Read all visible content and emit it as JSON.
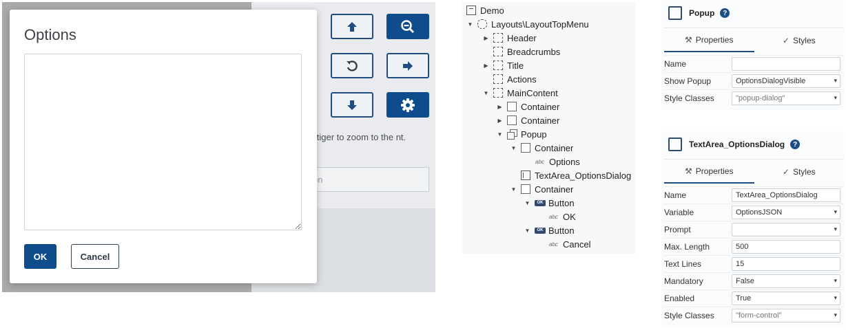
{
  "app": {
    "hint_text": "k the tiger to zoom to the nt.",
    "input_placeholder": "on",
    "buttons": [
      {
        "name": "pan-up-button",
        "icon": "arrow-up-icon"
      },
      {
        "name": "zoom-out-button",
        "icon": "zoom-out-icon"
      },
      {
        "name": "reset-button",
        "icon": "undo-icon"
      },
      {
        "name": "pan-right-button",
        "icon": "arrow-right-icon"
      },
      {
        "name": "pan-down-button",
        "icon": "arrow-down-icon"
      },
      {
        "name": "settings-button",
        "icon": "gear-icon"
      }
    ]
  },
  "dialog": {
    "title": "Options",
    "textarea_value": "",
    "ok_label": "OK",
    "cancel_label": "Cancel"
  },
  "tree": {
    "nodes": [
      {
        "label": "Demo",
        "icon": "home-icon",
        "arrow": "none"
      },
      {
        "label": "Layouts\\LayoutTopMenu",
        "icon": "layout-icon",
        "arrow": "down"
      },
      {
        "label": "Header",
        "icon": "region-icon",
        "arrow": "right"
      },
      {
        "label": "Breadcrumbs",
        "icon": "region-icon",
        "arrow": "none"
      },
      {
        "label": "Title",
        "icon": "region-icon",
        "arrow": "right"
      },
      {
        "label": "Actions",
        "icon": "region-icon",
        "arrow": "none"
      },
      {
        "label": "MainContent",
        "icon": "region-icon",
        "arrow": "down"
      },
      {
        "label": "Container",
        "icon": "container-icon",
        "arrow": "right"
      },
      {
        "label": "Container",
        "icon": "container-icon",
        "arrow": "right"
      },
      {
        "label": "Popup",
        "icon": "popup-icon",
        "arrow": "down"
      },
      {
        "label": "Container",
        "icon": "container-icon",
        "arrow": "down"
      },
      {
        "label": "Options",
        "icon": "text-icon",
        "arrow": "none"
      },
      {
        "label": "TextArea_OptionsDialog",
        "icon": "textarea-icon",
        "arrow": "none"
      },
      {
        "label": "Container",
        "icon": "container-icon",
        "arrow": "down"
      },
      {
        "label": "Button",
        "icon": "button-icon",
        "arrow": "down"
      },
      {
        "label": "OK",
        "icon": "text-icon",
        "arrow": "none"
      },
      {
        "label": "Button",
        "icon": "button-icon",
        "arrow": "down"
      },
      {
        "label": "Cancel",
        "icon": "text-icon",
        "arrow": "none"
      }
    ],
    "text_icon_label": "abc",
    "button_icon_label": "OK"
  },
  "popup_panel": {
    "title": "Popup",
    "tab_properties": "Properties",
    "tab_styles": "Styles",
    "rows": [
      {
        "label": "Name",
        "value": ""
      },
      {
        "label": "Show Popup",
        "value": "OptionsDialogVisible"
      },
      {
        "label": "Style Classes",
        "value": "\"popup-dialog\""
      }
    ]
  },
  "textarea_panel": {
    "title": "TextArea_OptionsDialog",
    "tab_properties": "Properties",
    "tab_styles": "Styles",
    "rows": [
      {
        "label": "Name",
        "value": "TextArea_OptionsDialog"
      },
      {
        "label": "Variable",
        "value": "OptionsJSON"
      },
      {
        "label": "Prompt",
        "value": ""
      },
      {
        "label": "Max. Length",
        "value": "500"
      },
      {
        "label": "Text Lines",
        "value": "15"
      },
      {
        "label": "Mandatory",
        "value": "False"
      },
      {
        "label": "Enabled",
        "value": "True"
      },
      {
        "label": "Style Classes",
        "value": "\"form-control\""
      }
    ]
  },
  "help_glyph": "?",
  "colors": {
    "accent": "#0e4c8b",
    "overlay": "#a9aaab"
  }
}
